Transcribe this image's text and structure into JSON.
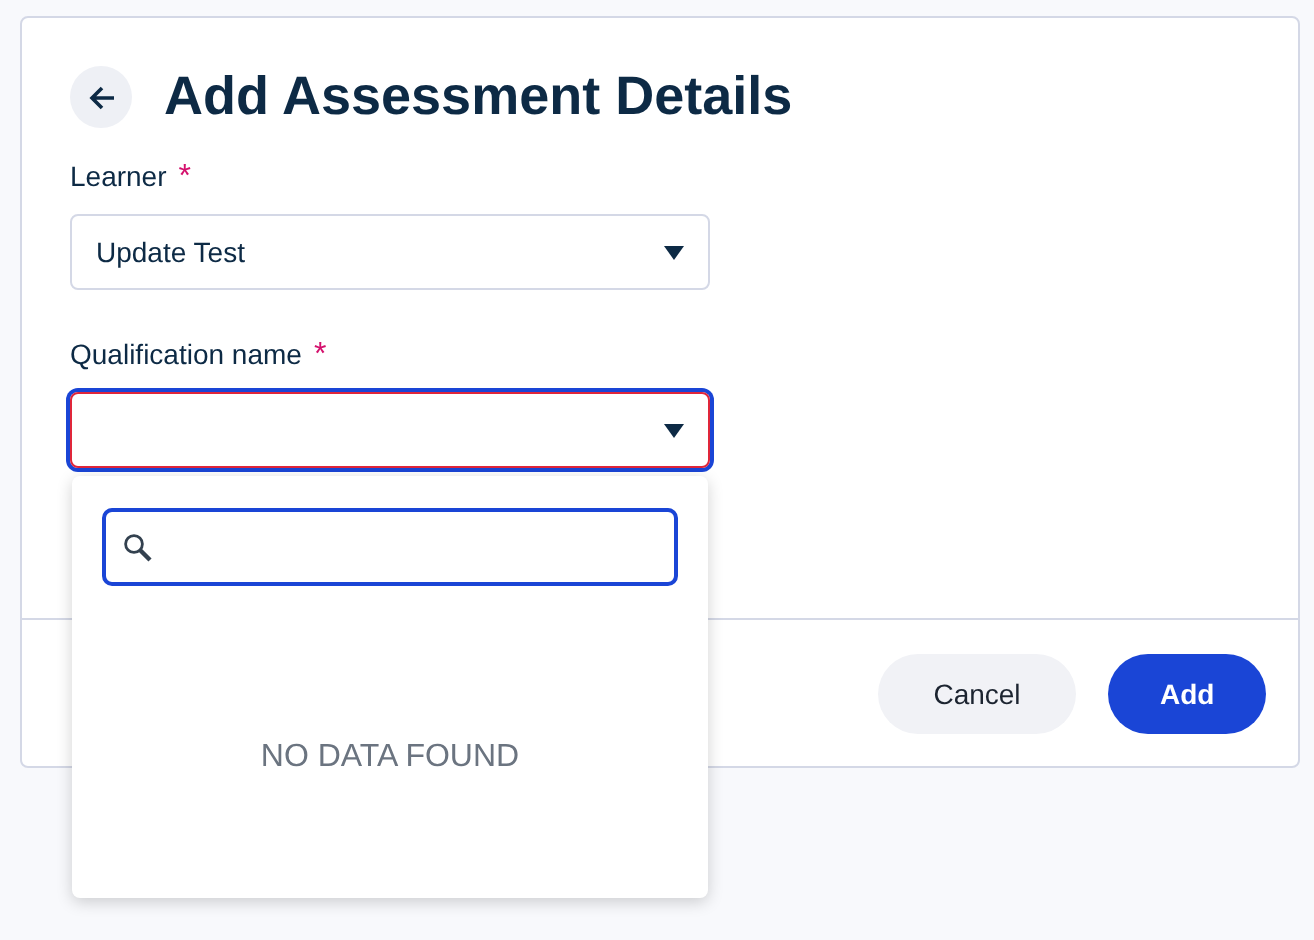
{
  "title": "Add Assessment Details",
  "fields": [
    {
      "label": "Learner",
      "required_mark": "*",
      "value": "Update Test",
      "invalid": false,
      "open": false
    },
    {
      "label": "Qualification name",
      "required_mark": "*",
      "invalid": true,
      "open": true,
      "dropdown": {
        "empty_text": "NO DATA FOUND"
      }
    }
  ],
  "buttons": [
    {
      "label": "Cancel",
      "kind": "secondary"
    },
    {
      "label": "Add",
      "kind": "primary"
    }
  ]
}
